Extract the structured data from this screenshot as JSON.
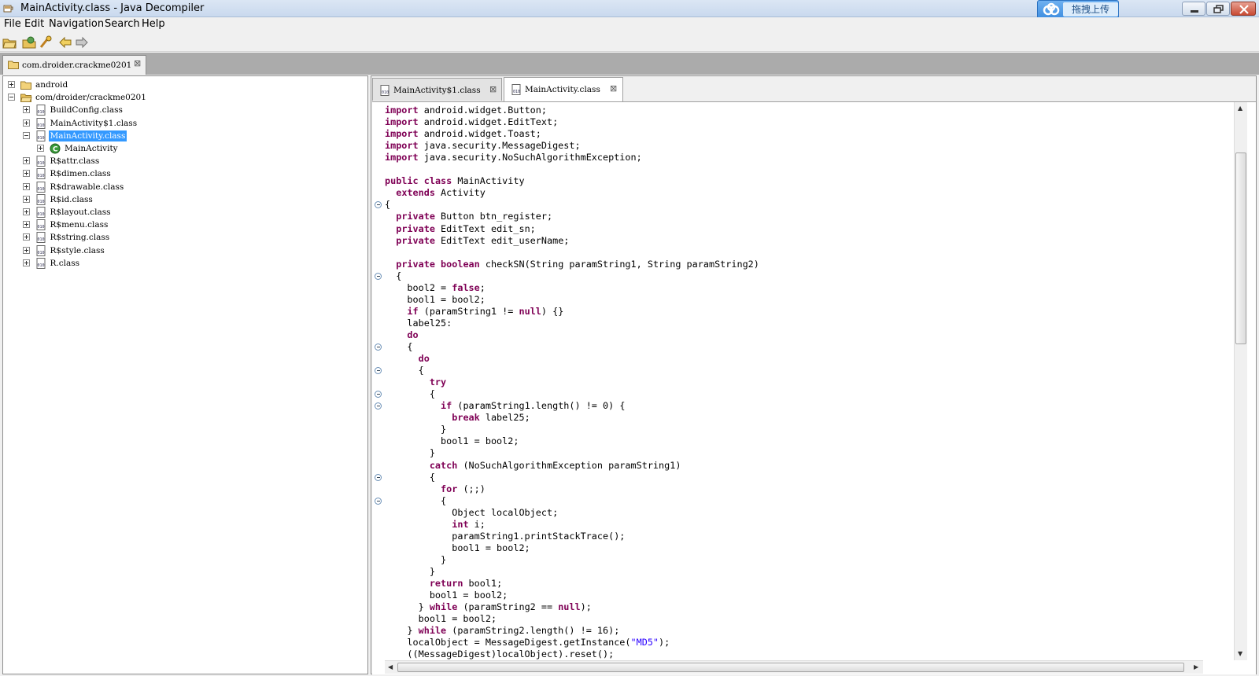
{
  "window": {
    "title": "MainActivity.class - Java Decompiler",
    "upload_label": "拖拽上传"
  },
  "menu": [
    "File",
    "Edit",
    "Navigation",
    "Search",
    "Help"
  ],
  "toolbar": [
    "open-file-icon",
    "open-folder-icon",
    "open-type-icon",
    "back-arrow-icon",
    "forward-arrow-icon"
  ],
  "package_tab": {
    "label": "com.droider.crackme0201"
  },
  "tree": {
    "items": [
      {
        "label": "android",
        "icon": "folder-icon",
        "level": 0
      },
      {
        "label": "com/droider/crackme0201",
        "icon": "folder-open-icon",
        "level": 0
      },
      {
        "label": "BuildConfig.class",
        "icon": "class-file-icon",
        "level": 1
      },
      {
        "label": "MainActivity$1.class",
        "icon": "class-file-icon",
        "level": 1
      },
      {
        "label": "MainActivity.class",
        "icon": "class-file-icon",
        "level": 1,
        "selected": true
      },
      {
        "label": "MainActivity",
        "icon": "class-icon",
        "level": 2
      },
      {
        "label": "R$attr.class",
        "icon": "class-file-icon",
        "level": 1
      },
      {
        "label": "R$dimen.class",
        "icon": "class-file-icon",
        "level": 1
      },
      {
        "label": "R$drawable.class",
        "icon": "class-file-icon",
        "level": 1
      },
      {
        "label": "R$id.class",
        "icon": "class-file-icon",
        "level": 1
      },
      {
        "label": "R$layout.class",
        "icon": "class-file-icon",
        "level": 1
      },
      {
        "label": "R$menu.class",
        "icon": "class-file-icon",
        "level": 1
      },
      {
        "label": "R$string.class",
        "icon": "class-file-icon",
        "level": 1
      },
      {
        "label": "R$style.class",
        "icon": "class-file-icon",
        "level": 1
      },
      {
        "label": "R.class",
        "icon": "class-file-icon",
        "level": 1
      }
    ]
  },
  "editor_tabs": [
    {
      "label": "MainActivity$1.class",
      "active": false
    },
    {
      "label": "MainActivity.class",
      "active": true
    }
  ],
  "code_lines": [
    "import android.widget.Button;",
    "import android.widget.EditText;",
    "import android.widget.Toast;",
    "import java.security.MessageDigest;",
    "import java.security.NoSuchAlgorithmException;",
    "",
    "public class MainActivity",
    "  extends Activity",
    "{",
    "  private Button btn_register;",
    "  private EditText edit_sn;",
    "  private EditText edit_userName;",
    "",
    "  private boolean checkSN(String paramString1, String paramString2)",
    "  {",
    "    bool2 = false;",
    "    bool1 = bool2;",
    "    if (paramString1 != null) {}",
    "    label25:",
    "    do",
    "    {",
    "      do",
    "      {",
    "        try",
    "        {",
    "          if (paramString1.length() != 0) {",
    "            break label25;",
    "          }",
    "          bool1 = bool2;",
    "        }",
    "        catch (NoSuchAlgorithmException paramString1)",
    "        {",
    "          for (;;)",
    "          {",
    "            Object localObject;",
    "            int i;",
    "            paramString1.printStackTrace();",
    "            bool1 = bool2;",
    "          }",
    "        }",
    "        return bool1;",
    "        bool1 = bool2;",
    "      } while (paramString2 == null);",
    "      bool1 = bool2;",
    "    } while (paramString2.length() != 16);",
    "    localObject = MessageDigest.getInstance(\"MD5\");",
    "    ((MessageDigest)localObject).reset();"
  ],
  "fold_lines": [
    8,
    14,
    20,
    22,
    24,
    25,
    31,
    33
  ]
}
